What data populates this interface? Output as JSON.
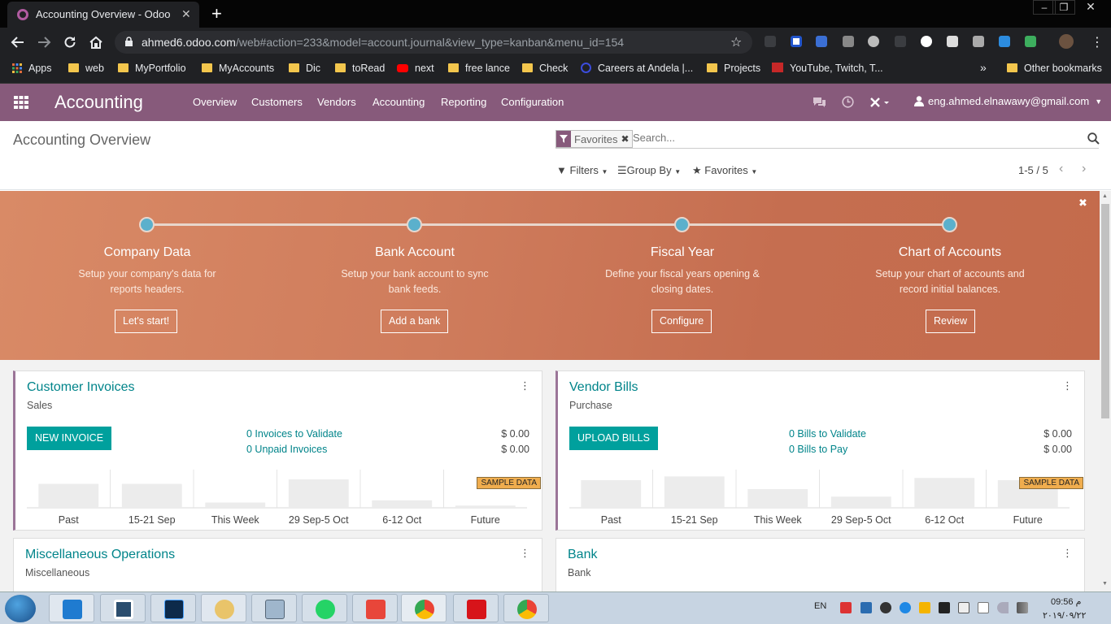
{
  "browser": {
    "tab_title": "Accounting Overview - Odoo",
    "url_host": "ahmed6.odoo.com",
    "url_path": "/web#action=233&model=account.journal&view_type=kanban&menu_id=154",
    "bookmarks": [
      "Apps",
      "web",
      "MyPortfolio",
      "MyAccounts",
      "Dic",
      "toRead",
      "next",
      "free lance",
      "Check",
      "Careers at Andela |...",
      "Projects",
      "YouTube, Twitch, T...",
      "Other bookmarks"
    ],
    "bookmarks_more": "»"
  },
  "nav": {
    "app_name": "Accounting",
    "menus": [
      "Overview",
      "Customers",
      "Vendors",
      "Accounting",
      "Reporting",
      "Configuration"
    ],
    "user": "eng.ahmed.elnawawy@gmail.com"
  },
  "control": {
    "breadcrumb": "Accounting Overview",
    "facet": "Favorites",
    "search_placeholder": "Search...",
    "filters": "Filters",
    "group_by": "Group By",
    "favorites": "Favorites",
    "pager": "1-5 / 5"
  },
  "banner": {
    "steps": [
      {
        "title": "Company Data",
        "desc1": "Setup your company's data for",
        "desc2": "reports headers.",
        "button": "Let's start!"
      },
      {
        "title": "Bank Account",
        "desc1": "Setup your bank account to sync",
        "desc2": "bank feeds.",
        "button": "Add a bank"
      },
      {
        "title": "Fiscal Year",
        "desc1": "Define your fiscal years opening &",
        "desc2": "closing dates.",
        "button": "Configure"
      },
      {
        "title": "Chart of Accounts",
        "desc1": "Setup your chart of accounts and",
        "desc2": "record initial balances.",
        "button": "Review"
      }
    ]
  },
  "journals": [
    {
      "title": "Customer Invoices",
      "type": "Sales",
      "button": "NEW INVOICE",
      "link1": "0 Invoices to Validate",
      "amount1": "$ 0.00",
      "link2": "0 Unpaid Invoices",
      "amount2": "$ 0.00",
      "sample": "SAMPLE DATA",
      "chart_data": {
        "type": "bar",
        "categories": [
          "Past",
          "15-21 Sep",
          "This Week",
          "29 Sep-5 Oct",
          "6-12 Oct",
          "Future"
        ],
        "values": [
          32,
          32,
          7,
          38,
          10,
          3
        ],
        "title": "",
        "xlabel": "",
        "ylabel": "",
        "grid": false
      }
    },
    {
      "title": "Vendor Bills",
      "type": "Purchase",
      "button": "UPLOAD BILLS",
      "link1": "0 Bills to Validate",
      "amount1": "$ 0.00",
      "link2": "0 Bills to Pay",
      "amount2": "$ 0.00",
      "sample": "SAMPLE DATA",
      "chart_data": {
        "type": "bar",
        "categories": [
          "Past",
          "15-21 Sep",
          "This Week",
          "29 Sep-5 Oct",
          "6-12 Oct",
          "Future"
        ],
        "values": [
          37,
          42,
          25,
          15,
          40,
          37
        ],
        "title": "",
        "xlabel": "",
        "ylabel": "",
        "grid": false
      }
    },
    {
      "title": "Miscellaneous Operations",
      "type": "Miscellaneous"
    },
    {
      "title": "Bank",
      "type": "Bank"
    }
  ],
  "taskbar": {
    "lang": "EN",
    "time": "09:56 م",
    "date": "٢٠١٩/٠٩/٢٢"
  },
  "colors": {
    "odoo_purple": "#875a7b",
    "teal": "#00a09d",
    "banner": "#c97555",
    "step_dot": "#5bb0cc"
  }
}
